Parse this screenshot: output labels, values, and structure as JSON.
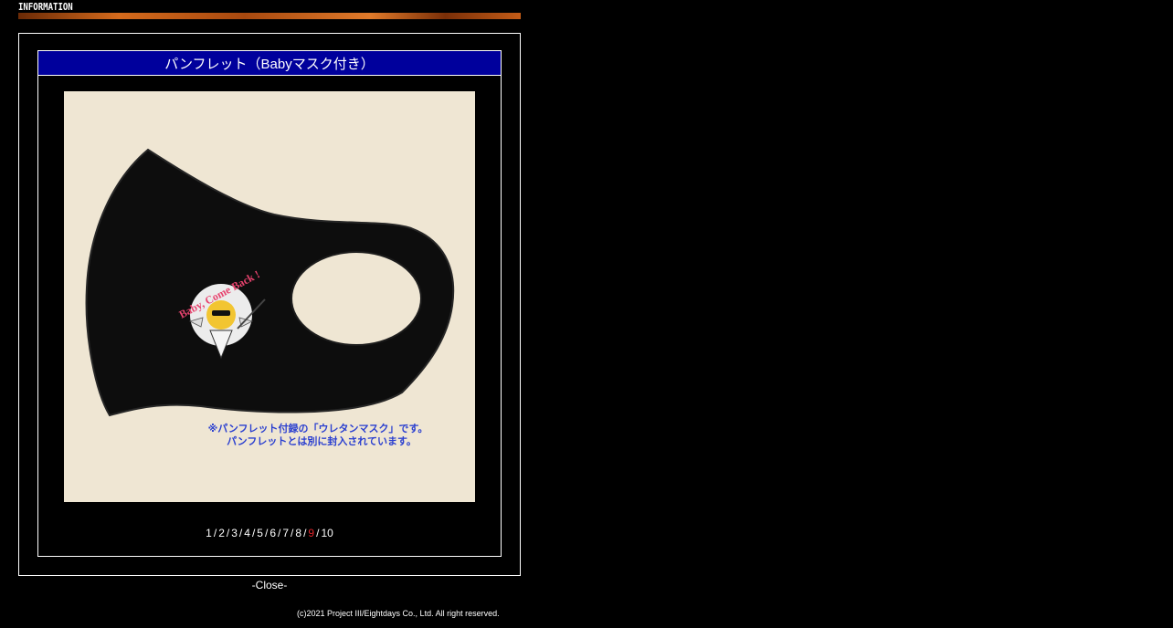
{
  "header": {
    "label": "INFORMATION"
  },
  "modal": {
    "title": "パンフレット（Babyマスク付き）",
    "image": {
      "logo_text": "Baby, Come Back !",
      "caption_line1": "※パンフレット付録の「ウレタンマスク」です。",
      "caption_line2": "パンフレットとは別に封入されています。"
    },
    "pagination": {
      "pages": [
        "1",
        "2",
        "3",
        "4",
        "5",
        "6",
        "7",
        "8",
        "9",
        "10"
      ],
      "current": "9",
      "separator": "/"
    }
  },
  "close_label": "-Close-",
  "footer": {
    "copyright": "(c)2021 Project III/Eightdays Co., Ltd. All right reserved."
  },
  "colors": {
    "background": "#000000",
    "title_bar": "#00009c",
    "current_page": "#e0242a",
    "image_bg": "#efe6d3",
    "caption": "#2a3fd0",
    "logo_pink": "#e8436e"
  }
}
